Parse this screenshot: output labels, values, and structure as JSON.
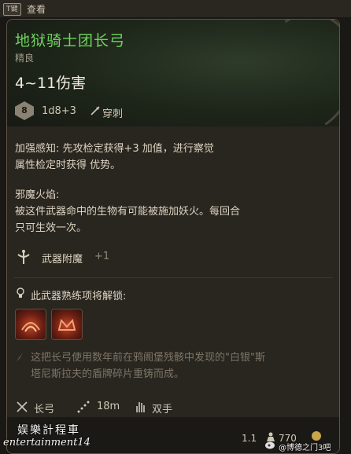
{
  "topbar": {
    "key": "T键",
    "label": "查看"
  },
  "item": {
    "name": "地狱骑士团长弓",
    "rarity": "精良",
    "damage": "4~11伤害",
    "die": "8",
    "formula": "1d8+3",
    "damage_type": "穿刺",
    "passive1": {
      "line1": "加强感知: 先攻检定获得+3 加值，进行察觉",
      "line2": "属性检定时获得 优势。"
    },
    "passive2": {
      "name": "邪魔火焰:",
      "line1": "被这件武器命中的生物有可能被施加妖火。每回合",
      "line2": "只可生效一次。"
    },
    "enchant": {
      "label": "武器附魔",
      "count": "+1"
    },
    "proficiency_unlock": "此武器熟练项将解锁:",
    "lore": {
      "line1": "这把长弓使用数年前在鸦阁堡残骸中发现的\"白银\"斯",
      "line2": "塔尼斯拉夫的盾牌碎片重铸而成。"
    },
    "properties": [
      {
        "icon": "longbow-icon",
        "label": "长弓"
      },
      {
        "icon": "range-icon",
        "label": "18m"
      },
      {
        "icon": "two-handed-icon",
        "label": "双手"
      }
    ],
    "weight": "1.1",
    "value": "770"
  },
  "watermark": {
    "cn": "娱樂計程車",
    "en": "entertainment14",
    "source": "@博德之门3吧"
  },
  "colors": {
    "name_uncommon": "#6fd45e",
    "fire_action": "#c44a2a",
    "gold": "#c9a64a"
  }
}
